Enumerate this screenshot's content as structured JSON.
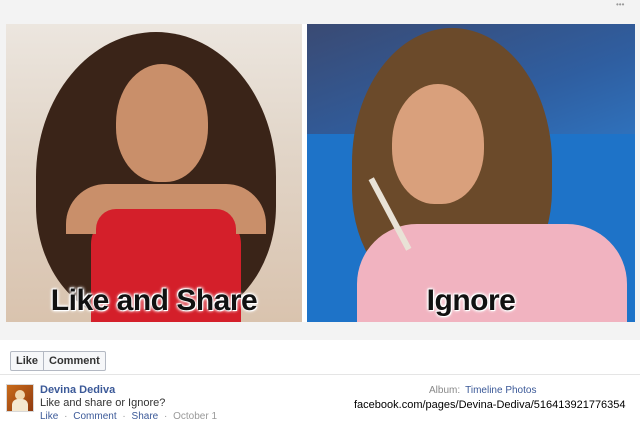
{
  "photo": {
    "left_caption": "Like and Share",
    "right_caption": "Ignore"
  },
  "actions": {
    "like_label": "Like",
    "comment_label": "Comment"
  },
  "post": {
    "author": "Devina Dediva",
    "text": "Like and share or Ignore?",
    "like_link": "Like",
    "comment_link": "Comment",
    "share_link": "Share",
    "separator": "·",
    "date": "October 1"
  },
  "album": {
    "label": "Album:",
    "name": "Timeline Photos"
  },
  "watermark": "facebook.com/pages/Devina-Dediva/516413921776354",
  "colors": {
    "link": "#3b5998",
    "muted": "#999999"
  }
}
